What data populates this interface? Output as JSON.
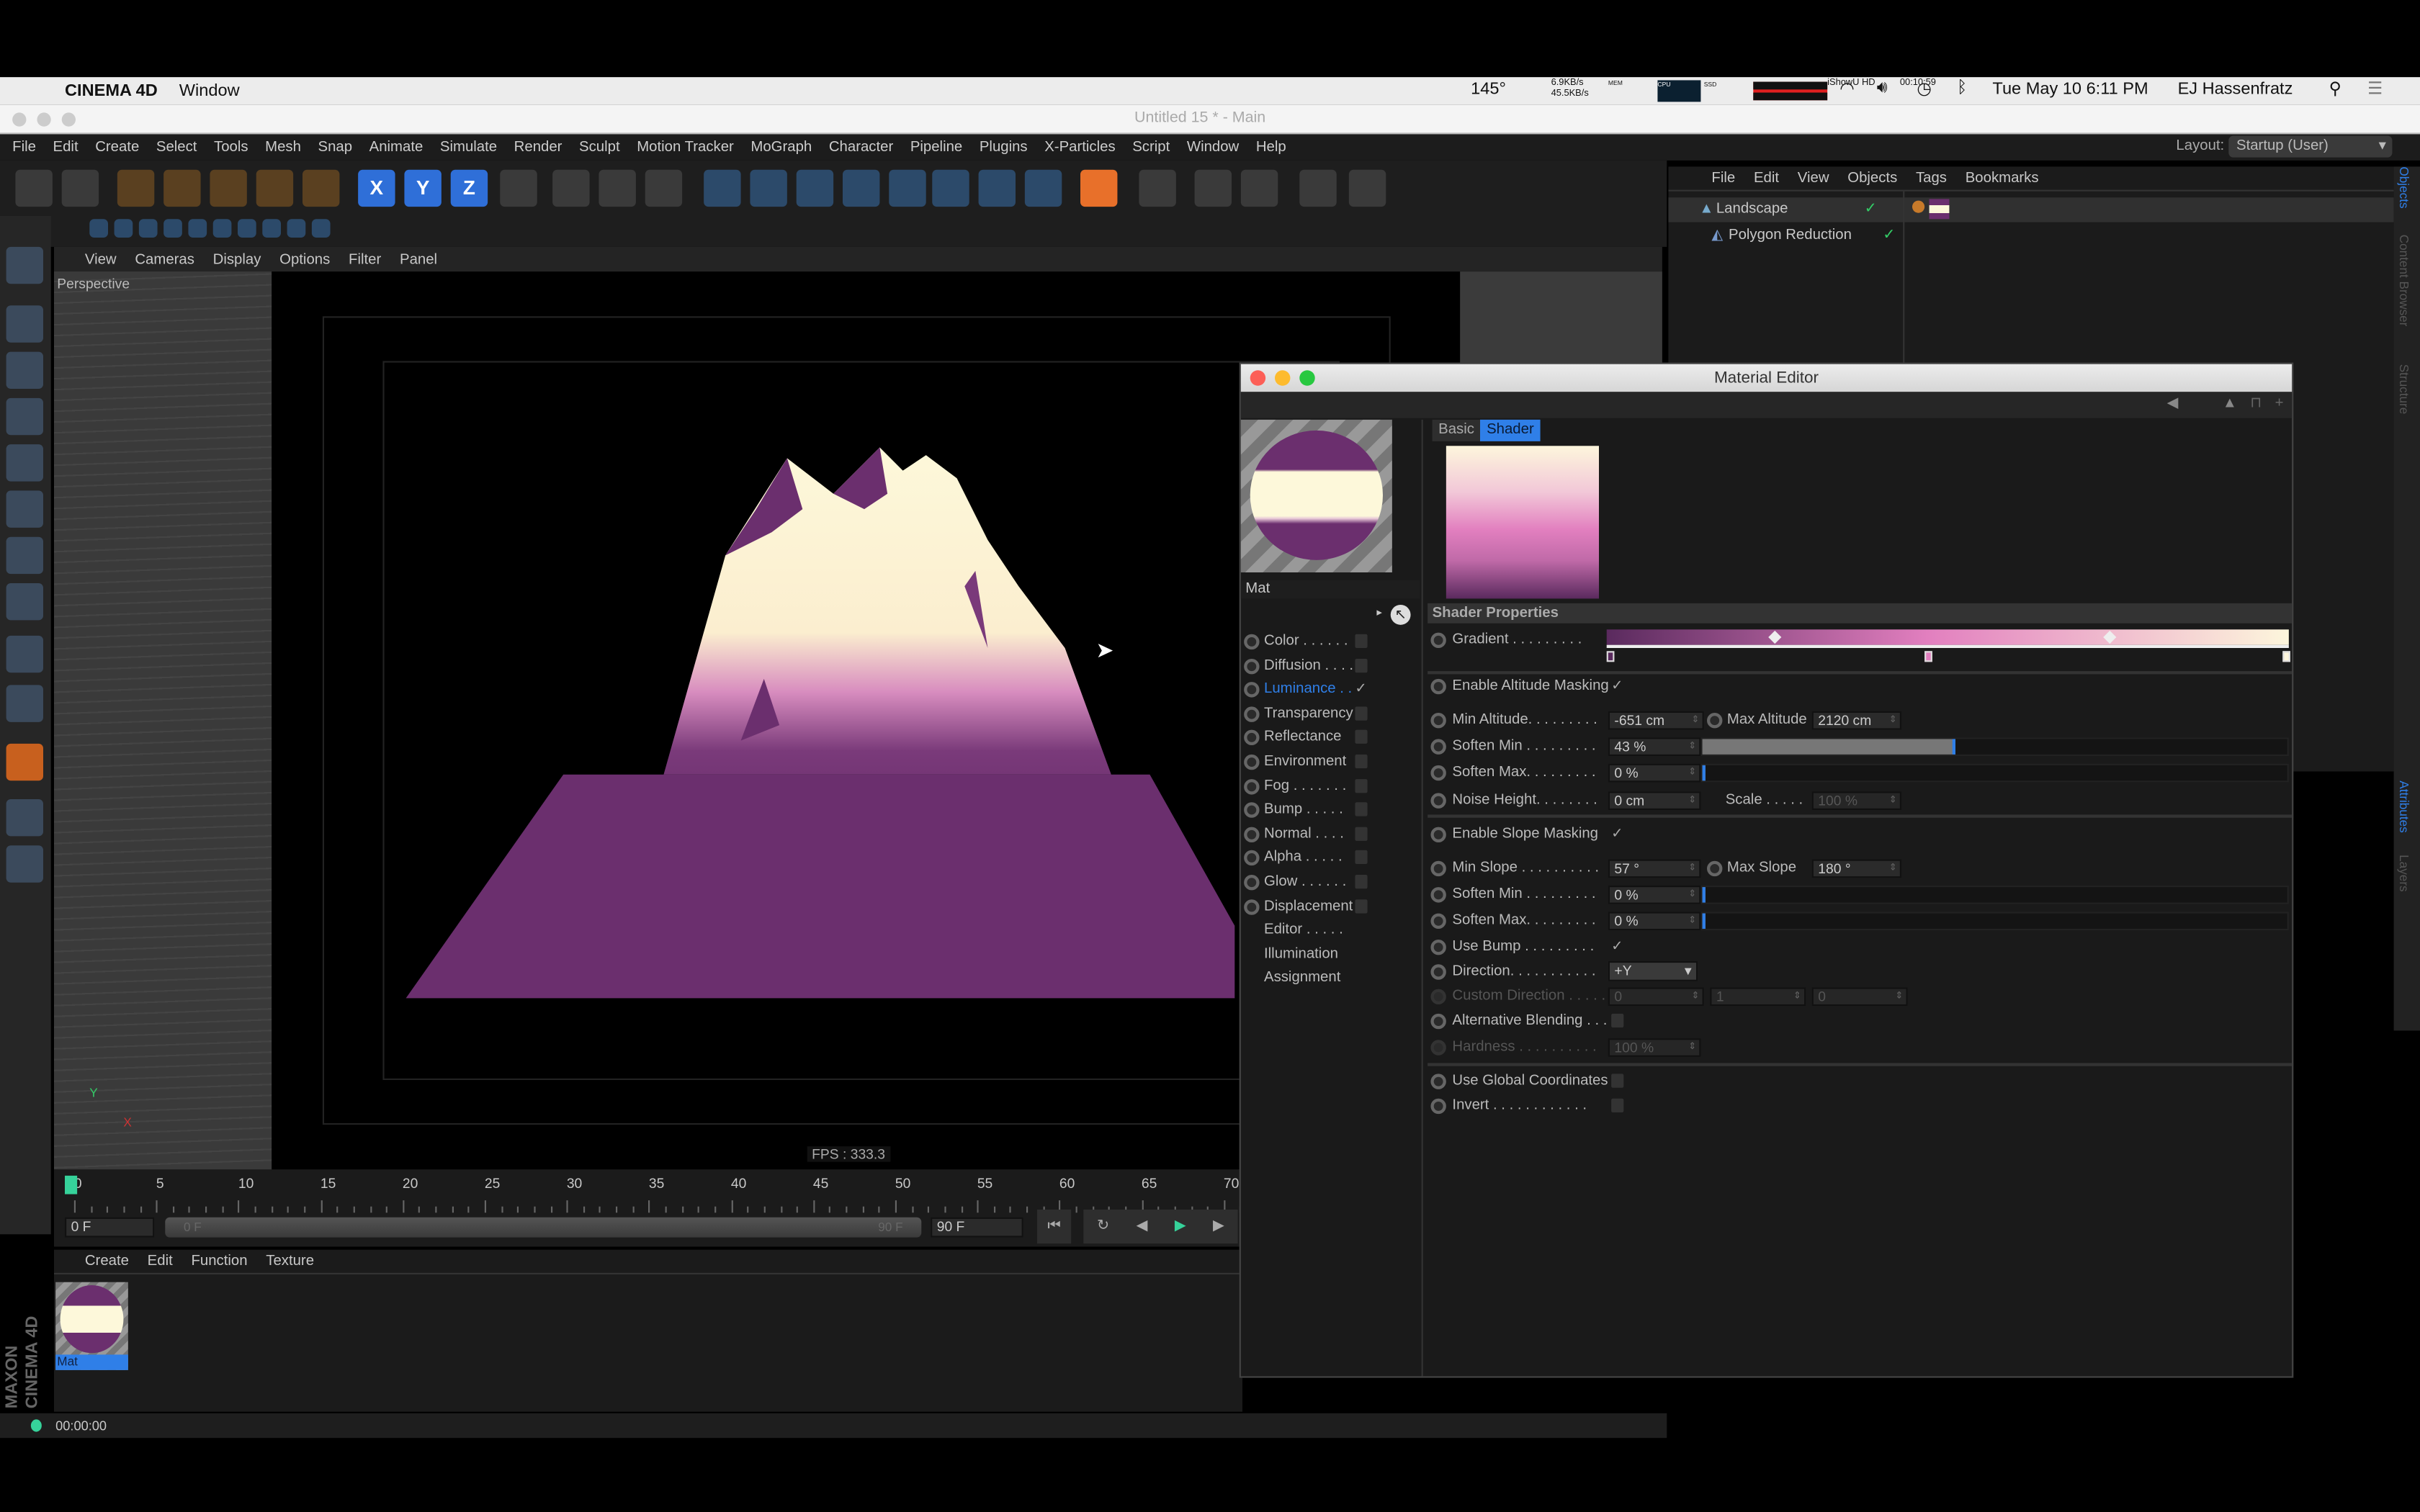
{
  "mac_menubar": {
    "apple": "",
    "app": "CINEMA 4D",
    "menus": [
      "Window"
    ],
    "ishowu": "iShowU HD",
    "ishowu_time": "00:10:59",
    "temp": "145°",
    "net_up": "6.9KB/s",
    "net_down": "45.5KB/s",
    "mem": "MEM",
    "cpu": "CPU",
    "ssd": "SSD",
    "datetime": "Tue May 10  6:11 PM",
    "user": "EJ Hassenfratz"
  },
  "window": {
    "title": "Untitled 15 * - Main"
  },
  "main_menu": [
    "File",
    "Edit",
    "Create",
    "Select",
    "Tools",
    "Mesh",
    "Snap",
    "Animate",
    "Simulate",
    "Render",
    "Sculpt",
    "Motion Tracker",
    "MoGraph",
    "Character",
    "Pipeline",
    "Plugins",
    "X-Particles",
    "Script",
    "Window",
    "Help"
  ],
  "layout": {
    "label": "Layout:",
    "value": "Startup (User)"
  },
  "toolbar_icons": [
    "undo-icon",
    "redo-icon",
    "select-icon",
    "move-icon",
    "scale-icon",
    "rotate-icon",
    "add-icon",
    "x-axis-icon",
    "y-axis-icon",
    "z-axis-icon",
    "coordinate-system-icon",
    "render-view-icon",
    "render-picture-viewer-icon",
    "render-settings-icon",
    "landscape-icon",
    "spline-icon",
    "nurbs-icon",
    "array-icon",
    "deformer-icon",
    "floor-icon",
    "camera-icon",
    "light-icon",
    "script-icon",
    "cube-icon",
    "axis-icon",
    "xpresso-icon",
    "psr-icon",
    "snap-icon"
  ],
  "toolbar_axis": [
    "X",
    "Y",
    "Z"
  ],
  "viewport": {
    "menu": [
      "View",
      "Cameras",
      "Display",
      "Options",
      "Filter",
      "Panel"
    ],
    "label": "Perspective",
    "fps": "FPS : 333.3",
    "axis_y": "Y",
    "axis_x": "X"
  },
  "timeline": {
    "ticks": [
      "0",
      "5",
      "10",
      "15",
      "20",
      "25",
      "30",
      "35",
      "40",
      "45",
      "50",
      "55",
      "60",
      "65",
      "70"
    ],
    "current": "0 F",
    "range_start": "0 F",
    "range_end": "90 F",
    "end": "90 F"
  },
  "material_manager": {
    "menu": [
      "Create",
      "Edit",
      "Function",
      "Texture"
    ],
    "material": "Mat"
  },
  "status": {
    "time": "00:00:00",
    "logo": "MAXON CINEMA 4D"
  },
  "object_manager": {
    "menu": [
      "File",
      "Edit",
      "View",
      "Objects",
      "Tags",
      "Bookmarks"
    ],
    "objects": [
      {
        "name": "Landscape"
      },
      {
        "name": "Polygon Reduction"
      }
    ]
  },
  "right_tabs": [
    "Objects",
    "Content Browser",
    "Structure",
    "Attributes",
    "Layers"
  ],
  "material_editor": {
    "title": "Material Editor",
    "name": "Mat",
    "tabs": [
      "Basic",
      "Shader"
    ],
    "active_tab": "Shader",
    "channels": [
      {
        "label": "Color . . . . . .",
        "on": false
      },
      {
        "label": "Diffusion . . . .",
        "on": false
      },
      {
        "label": "Luminance . .",
        "on": true,
        "active": true
      },
      {
        "label": "Transparency",
        "on": false
      },
      {
        "label": "Reflectance",
        "on": false
      },
      {
        "label": "Environment",
        "on": false
      },
      {
        "label": "Fog . . . . . . .",
        "on": false
      },
      {
        "label": "Bump . . . . .",
        "on": false
      },
      {
        "label": "Normal . . . .",
        "on": false
      },
      {
        "label": "Alpha . . . . .",
        "on": false
      },
      {
        "label": "Glow . . . . . .",
        "on": false
      },
      {
        "label": "Displacement",
        "on": false
      }
    ],
    "extra": [
      "Editor . . . . .",
      "Illumination",
      "Assignment"
    ],
    "section": "Shader Properties",
    "gradient": {
      "label": "Gradient . . . . . . . . .",
      "colors": [
        "#5a2a5e",
        "#e27fbf",
        "#fdf6dc"
      ],
      "knots": [
        0,
        0.47,
        1
      ]
    },
    "altitude": {
      "enable": "Enable Altitude Masking",
      "enabled": true,
      "min_label": "Min Altitude. . . . . . . . .",
      "min": "-651 cm",
      "max_label": "Max Altitude",
      "max": "2120 cm",
      "soften_min_label": "Soften Min . . . . . . . . .",
      "soften_min": "43 %",
      "soften_min_value": 43,
      "soften_max_label": "Soften Max. . . . . . . . .",
      "soften_max": "0 %",
      "soften_max_value": 0,
      "noise_label": "Noise Height. . . . . . . .",
      "noise": "0 cm",
      "scale_label": "Scale . . . . .",
      "scale": "100 %"
    },
    "slope": {
      "enable": "Enable Slope Masking",
      "enabled": true,
      "min_label": "Min Slope . . . . . . . . . .",
      "min": "57 °",
      "max_label": "Max Slope",
      "max": "180 °",
      "soften_min_label": "Soften Min . . . . . . . . .",
      "soften_min": "0 %",
      "soften_max_label": "Soften Max. . . . . . . . .",
      "soften_max": "0 %",
      "bump_label": "Use Bump . . . . . . . . .",
      "bump": true,
      "direction_label": "Direction. . . . . . . . . . .",
      "direction": "+Y",
      "custom_label": "Custom Direction . . . . .",
      "custom": [
        "0",
        "1",
        "0"
      ],
      "alt_label": "Alternative Blending . . .",
      "alt": false,
      "hardness_label": "Hardness . . . . . . . . . .",
      "hardness": "100 %"
    },
    "global_label": "Use Global Coordinates",
    "global": false,
    "invert_label": "Invert . . . . . . . . . . . .",
    "invert": false
  },
  "colors": {
    "accent": "#2f7fe8",
    "mountain_purple": "#6b2f6e",
    "mountain_cream": "#fdf8da",
    "play": "#36d29a"
  }
}
